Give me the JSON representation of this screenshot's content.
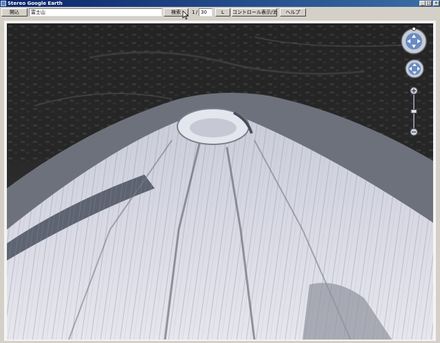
{
  "window": {
    "title": "Stereo Google Earth"
  },
  "toolbar": {
    "open_label": "開込",
    "search_value": "富士山",
    "search_label": "検索",
    "page_current": "1",
    "page_separator": "/",
    "page_total": "30",
    "small_button_label": "L",
    "controls_label": "コントロール表示/消去",
    "help_label": "ヘルプ"
  },
  "map_controls": {
    "look_icon": "look-around-icon",
    "move_icon": "move-arrows-icon",
    "zoom_in_icon": "plus-icon",
    "zoom_out_icon": "minus-icon",
    "zoom_level": 0.5
  },
  "colors": {
    "titlebar": "#0a246a",
    "chrome": "#d4d0c8",
    "control_blue": "#5a7fc0"
  }
}
